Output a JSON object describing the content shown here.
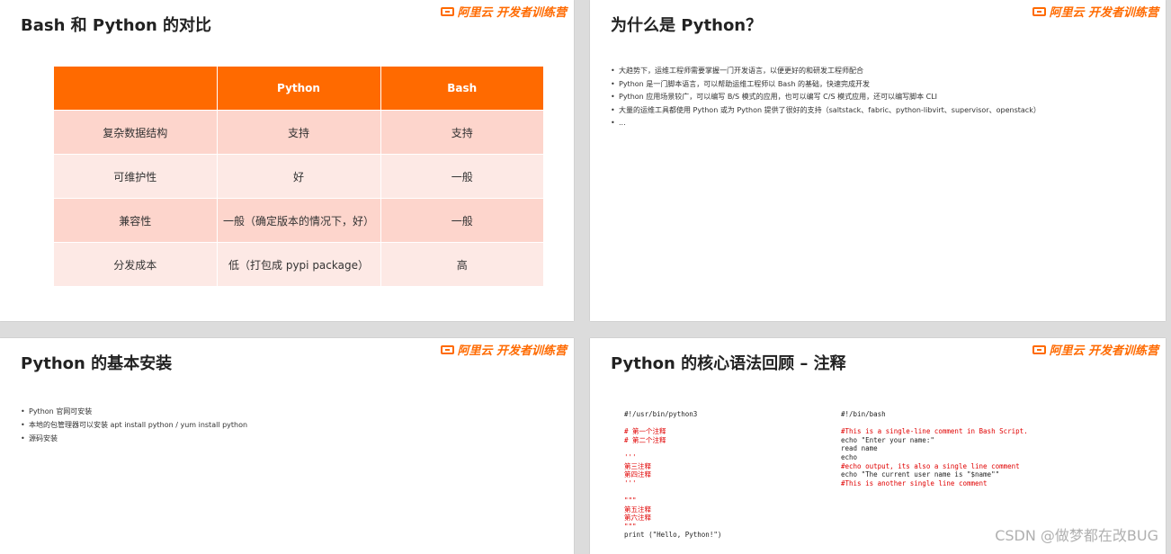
{
  "brand": {
    "logo_text": "阿里云 开发者训练营",
    "accent": "#ff6a00"
  },
  "slides": {
    "s1": {
      "title": "Bash 和 Python 的对比",
      "table": {
        "headers": [
          "",
          "Python",
          "Bash"
        ],
        "rows": [
          [
            "复杂数据结构",
            "支持",
            "支持"
          ],
          [
            "可维护性",
            "好",
            "一般"
          ],
          [
            "兼容性",
            "一般（确定版本的情况下，好）",
            "一般"
          ],
          [
            "分发成本",
            "低（打包成 pypi package）",
            "高"
          ]
        ]
      }
    },
    "s2": {
      "title": "为什么是 Python？",
      "bullets": [
        "大趋势下，运维工程师需要掌握一门开发语言，以便更好的和研发工程师配合",
        "Python 是一门脚本语言，可以帮助运维工程师以 Bash 的基础，快速完成开发",
        "Python 应用场景较广，可以编写 B/S 模式的应用，也可以编写 C/S 模式应用，还可以编写脚本 CLI",
        "大量的运维工具都使用 Python 或为 Python 提供了很好的支持（saltstack、fabric、python-libvirt、supervisor、openstack）",
        "..."
      ]
    },
    "s3": {
      "title": "Python 的基本安装",
      "bullets": [
        "Python 官网可安装",
        "本地的包管理器可以安装 apt install python / yum install python",
        "源码安装"
      ]
    },
    "s4": {
      "title": "Python 的核心语法回顾 – 注释",
      "python_code": [
        {
          "t": "#!/usr/bin/python3",
          "c": false
        },
        {
          "t": "",
          "c": false
        },
        {
          "t": "# 第一个注释",
          "c": true
        },
        {
          "t": "# 第二个注释",
          "c": true
        },
        {
          "t": "",
          "c": false
        },
        {
          "t": "'''",
          "c": true
        },
        {
          "t": "第三注释",
          "c": true
        },
        {
          "t": "第四注释",
          "c": true
        },
        {
          "t": "'''",
          "c": true
        },
        {
          "t": "",
          "c": false
        },
        {
          "t": "\"\"\"",
          "c": true
        },
        {
          "t": "第五注释",
          "c": true
        },
        {
          "t": "第六注释",
          "c": true
        },
        {
          "t": "\"\"\"",
          "c": true
        },
        {
          "t": "print (\"Hello, Python!\")",
          "c": false
        }
      ],
      "bash_code": [
        {
          "t": "#!/bin/bash",
          "c": false
        },
        {
          "t": "",
          "c": false
        },
        {
          "t": "#This is a single-line comment in Bash Script.",
          "c": true
        },
        {
          "t": "echo \"Enter your name:\"",
          "c": false
        },
        {
          "t": "read name",
          "c": false
        },
        {
          "t": "echo",
          "c": false
        },
        {
          "t": "#echo output, its also a single line comment",
          "c": true
        },
        {
          "t": "echo \"The current user name is \"$name\"\"",
          "c": false
        },
        {
          "t": "#This is another single line comment",
          "c": true
        }
      ]
    }
  },
  "watermark": "CSDN @做梦都在改BUG"
}
